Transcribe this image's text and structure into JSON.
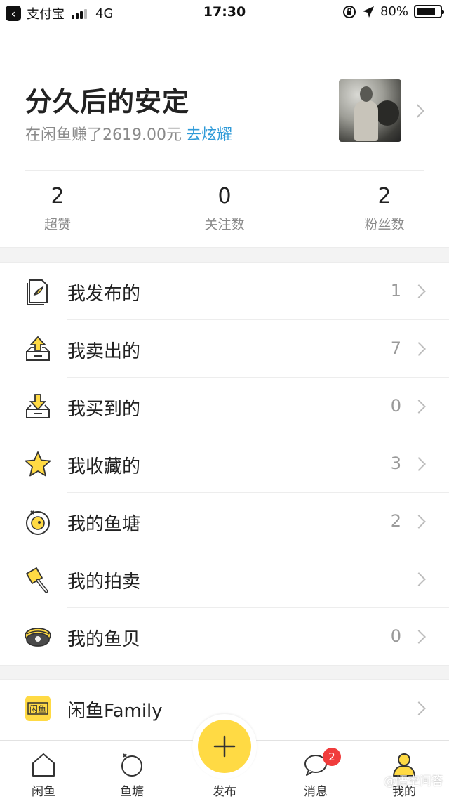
{
  "status_bar": {
    "back_app": "支付宝",
    "network": "4G",
    "time": "17:30",
    "battery": "80%",
    "battery_level": 0.8
  },
  "profile": {
    "name": "分久后的安定",
    "earned_text": "在闲鱼赚了2619.00元",
    "show_off_link": "去炫耀"
  },
  "stats": [
    {
      "value": "2",
      "label": "超赞"
    },
    {
      "value": "0",
      "label": "关注数"
    },
    {
      "value": "2",
      "label": "粉丝数"
    }
  ],
  "menu": [
    {
      "label": "我发布的",
      "count": "1",
      "icon": "published-doc-icon"
    },
    {
      "label": "我卖出的",
      "count": "7",
      "icon": "sold-tray-up-icon"
    },
    {
      "label": "我买到的",
      "count": "0",
      "icon": "bought-tray-down-icon"
    },
    {
      "label": "我收藏的",
      "count": "3",
      "icon": "star-icon"
    },
    {
      "label": "我的鱼塘",
      "count": "2",
      "icon": "fishpond-icon"
    },
    {
      "label": "我的拍卖",
      "count": "",
      "icon": "auction-hammer-icon"
    },
    {
      "label": "我的鱼贝",
      "count": "0",
      "icon": "shell-icon"
    }
  ],
  "family": {
    "label": "闲鱼Family",
    "icon_text": "闲鱼",
    "icon": "xianyu-family-icon"
  },
  "tabbar": {
    "tabs": [
      {
        "label": "闲鱼",
        "icon": "home-icon"
      },
      {
        "label": "鱼塘",
        "icon": "pond-icon"
      },
      {
        "label": "发布",
        "icon": "plus-icon"
      },
      {
        "label": "消息",
        "icon": "message-icon",
        "badge": "2"
      },
      {
        "label": "我的",
        "icon": "profile-icon"
      }
    ]
  },
  "watermark": "@悟空问答",
  "colors": {
    "accent_yellow": "#ffda44",
    "link_blue": "#2e9ad8",
    "badge_red": "#f03c3c"
  }
}
